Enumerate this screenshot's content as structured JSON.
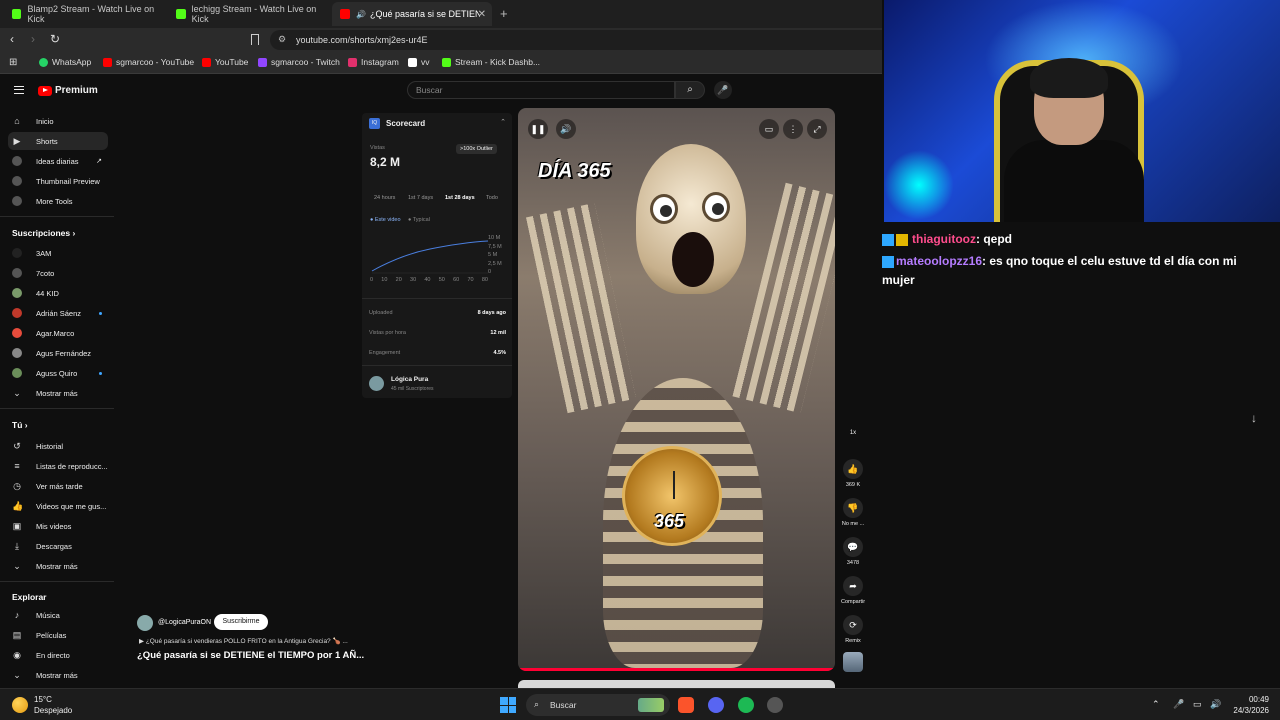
{
  "tabs": [
    {
      "label": "Blamp2 Stream - Watch Live on Kick",
      "color": "#53fc18"
    },
    {
      "label": "lechigg Stream - Watch Live on Kick",
      "color": "#53fc18"
    },
    {
      "label": "¿Qué pasaría si se DETIENE el",
      "color": "#ff0000"
    }
  ],
  "address": {
    "url": "youtube.com/shorts/xmj2es-ur4E"
  },
  "bookmarks": [
    {
      "label": "WhatsApp",
      "color": "#25d366"
    },
    {
      "label": "sgmarcoo - YouTube",
      "color": "#ff0000"
    },
    {
      "label": "YouTube",
      "color": "#ff0000"
    },
    {
      "label": "sgmarcoo - Twitch",
      "color": "#9146ff"
    },
    {
      "label": "Instagram",
      "color": "#e1306c"
    },
    {
      "label": "vv",
      "color": "#ffffff"
    },
    {
      "label": "Stream - Kick Dashb...",
      "color": "#53fc18"
    }
  ],
  "youtube": {
    "logo": "Premium",
    "search_placeholder": "Buscar",
    "nav": [
      {
        "label": "Inicio",
        "icon": "home-icon"
      },
      {
        "label": "Shorts",
        "icon": "shorts-icon"
      },
      {
        "label": "Ideas diarias",
        "icon": "ideas-icon"
      },
      {
        "label": "Thumbnail Preview",
        "icon": "thumbnail-icon"
      },
      {
        "label": "More Tools",
        "icon": "tools-icon"
      }
    ],
    "subs_heading": "Suscripciones",
    "subs": [
      {
        "label": "3AM",
        "color": "#222"
      },
      {
        "label": "7coto",
        "color": "#555"
      },
      {
        "label": "44 KID",
        "color": "#7a9a6a"
      },
      {
        "label": "Adrián Sáenz",
        "color": "#c0392b"
      },
      {
        "label": "Agar.Marco",
        "color": "#e74c3c"
      },
      {
        "label": "Agus Fernández",
        "color": "#888"
      },
      {
        "label": "Aguss Quiro",
        "color": "#6b8e5a"
      }
    ],
    "show_more": "Mostrar más",
    "you_heading": "Tú",
    "you": [
      {
        "label": "Historial",
        "icon": "history-icon"
      },
      {
        "label": "Listas de reproducc...",
        "icon": "playlist-icon"
      },
      {
        "label": "Ver más tarde",
        "icon": "clock-icon"
      },
      {
        "label": "Videos que me gus...",
        "icon": "like-icon"
      },
      {
        "label": "Mis videos",
        "icon": "video-icon"
      },
      {
        "label": "Descargas",
        "icon": "download-icon"
      }
    ],
    "explore_heading": "Explorar",
    "explore": [
      {
        "label": "Música",
        "icon": "music-icon"
      },
      {
        "label": "Películas",
        "icon": "film-icon"
      },
      {
        "label": "En directo",
        "icon": "live-icon"
      }
    ]
  },
  "scorecard": {
    "title": "Scorecard",
    "views_label": "Vistas",
    "views": "8,2 M",
    "outlier": ">100x Outlier",
    "ranges": [
      "24 hours",
      "1st 7 days",
      "1st 28 days",
      "Todo"
    ],
    "legend_a": "● Este video",
    "legend_b": "● Typical",
    "y_ticks": [
      "10 M",
      "7,5 M",
      "5 M",
      "2,5 M",
      "0"
    ],
    "x_ticks": [
      "0",
      "10",
      "20",
      "30",
      "40",
      "50",
      "60",
      "70",
      "80"
    ],
    "uploaded_label": "Uploaded",
    "uploaded": "8 days ago",
    "per_hour_label": "Vistas por hora",
    "per_hour": "12 mil",
    "engagement_label": "Engagement",
    "engagement": "4.5%",
    "channel": "Lógica Pura",
    "channel_subs": "45 mil Suscriptores"
  },
  "video": {
    "overlay_title": "DÍA 365",
    "overlay_number": "365",
    "speed": "1x",
    "likes": "369 K",
    "dislike": "No me ...",
    "comments": "3478",
    "share": "Compartir",
    "remix": "Remix",
    "channel": "@LogicaPuraON",
    "subscribe": "Suscribirme",
    "related": "¿Qué pasaría si vendieras POLLO FRITO en la Antigua Grecia? 🍗 ...",
    "title": "¿Qué pasaría si se DETIENE el TIEMPO por 1 AÑ..."
  },
  "chat": [
    {
      "user": "thiaguitooz",
      "text": ": qepd",
      "color": "#ff4d8d"
    },
    {
      "user": "mateoolopzz16",
      "text": ": es qno toque el celu estuve td el día con mi mujer",
      "color": "#b57cff"
    }
  ],
  "taskbar": {
    "temp": "15°C",
    "weather": "Despejado",
    "search": "Buscar",
    "time": "00:49",
    "date": "24/3/2026"
  }
}
